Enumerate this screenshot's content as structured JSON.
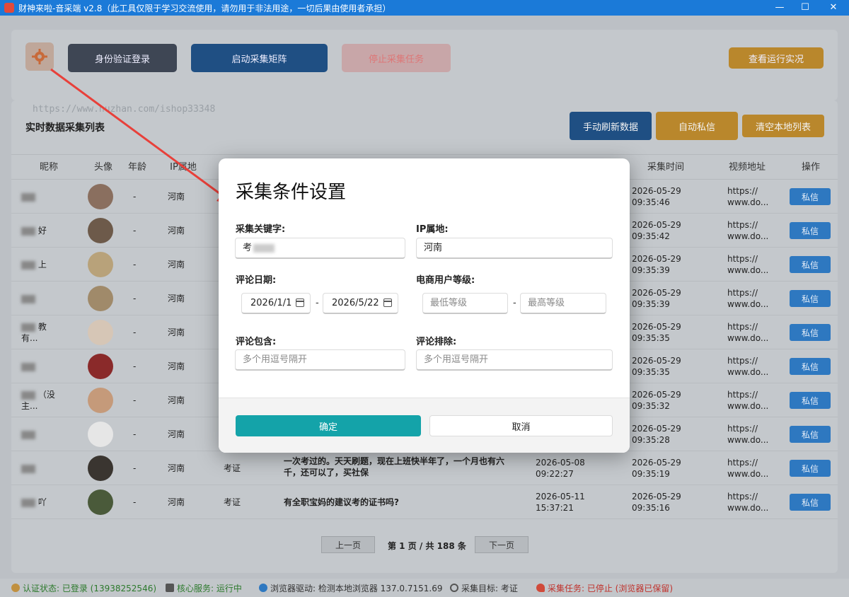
{
  "window": {
    "title": "财神来啦-音采端 v2.8（此工具仅限于学习交流使用，请勿用于非法用途，一切后果由使用者承担）"
  },
  "toolbar": {
    "login": "身份验证登录",
    "start": "启动采集矩阵",
    "stop": "停止采集任务",
    "view": "查看运行实况"
  },
  "list": {
    "watermark": "https://www.huzhan.com/ishop33348",
    "title": "实时数据采集列表",
    "refresh": "手动刷新数据",
    "auto_dm": "自动私信",
    "clear": "清空本地列表",
    "headers": [
      "昵称",
      "头像",
      "年龄",
      "IP属地",
      "采集时间",
      "视频地址",
      "操作"
    ],
    "rows": [
      {
        "nick": "    ",
        "age": "-",
        "ip": "河南",
        "kw": "",
        "comment": "",
        "ctime1": "",
        "ctime2": "",
        "time1": "2026-05-29",
        "time2": "09:35:46",
        "url1": "https://",
        "url2": "www.do...",
        "action": "私信"
      },
      {
        "nick": "    好",
        "age": "-",
        "ip": "河南",
        "kw": "",
        "comment": "",
        "ctime1": "",
        "ctime2": "",
        "time1": "2026-05-29",
        "time2": "09:35:42",
        "url1": "https://",
        "url2": "www.do...",
        "action": "私信"
      },
      {
        "nick": "    上",
        "age": "-",
        "ip": "河南",
        "kw": "",
        "comment": "",
        "ctime1": "",
        "ctime2": "",
        "time1": "2026-05-29",
        "time2": "09:35:39",
        "url1": "https://",
        "url2": "www.do...",
        "action": "私信"
      },
      {
        "nick": "    ",
        "age": "-",
        "ip": "河南",
        "kw": "",
        "comment": "",
        "ctime1": "",
        "ctime2": "",
        "time1": "2026-05-29",
        "time2": "09:35:39",
        "url1": "https://",
        "url2": "www.do...",
        "action": "私信"
      },
      {
        "nick": "  教",
        "nick2": "  有...",
        "age": "-",
        "ip": "河南",
        "kw": "",
        "comment": "",
        "ctime1": "",
        "ctime2": "",
        "time1": "2026-05-29",
        "time2": "09:35:35",
        "url1": "https://",
        "url2": "www.do...",
        "action": "私信"
      },
      {
        "nick": "    ",
        "age": "-",
        "ip": "河南",
        "kw": "",
        "comment": "",
        "ctime1": "",
        "ctime2": "",
        "time1": "2026-05-29",
        "time2": "09:35:35",
        "url1": "https://",
        "url2": "www.do...",
        "action": "私信"
      },
      {
        "nick": "  （没",
        "nick2": "  主...",
        "age": "-",
        "ip": "河南",
        "kw": "",
        "comment": "",
        "ctime1": "",
        "ctime2": "",
        "time1": "2026-05-29",
        "time2": "09:35:32",
        "url1": "https://",
        "url2": "www.do...",
        "action": "私信"
      },
      {
        "nick": "    ",
        "age": "-",
        "ip": "河南",
        "kw": "",
        "comment": "",
        "ctime1": "",
        "ctime2": "",
        "time1": "2026-05-29",
        "time2": "09:35:28",
        "url1": "https://",
        "url2": "www.do...",
        "action": "私信"
      },
      {
        "nick": "    ",
        "age": "-",
        "ip": "河南",
        "kw": "考证",
        "comment": "一次考过的。天天刷题，现在上班快半年了，一个月也有六千，还可以了，买社保",
        "ctime1": "2026-05-08",
        "ctime2": "09:22:27",
        "time1": "2026-05-29",
        "time2": "09:35:19",
        "url1": "https://",
        "url2": "www.do...",
        "action": "私信"
      },
      {
        "nick": "  吖",
        "age": "-",
        "ip": "河南",
        "kw": "考证",
        "comment": "有全职宝妈的建议考的证书吗?",
        "ctime1": "2026-05-11",
        "ctime2": "15:37:21",
        "time1": "2026-05-29",
        "time2": "09:35:16",
        "url1": "https://",
        "url2": "www.do...",
        "action": "私信"
      }
    ],
    "pager": {
      "prev": "上一页",
      "info": "第 1 页 / 共 188 条",
      "next": "下一页"
    }
  },
  "status": {
    "auth": "认证状态: 已登录 (13938252546)",
    "core": "核心服务: 运行中",
    "browser": "浏览器驱动: 检测本地浏览器 137.0.7151.69",
    "target": "采集目标: 考证",
    "task": "采集任务: 已停止 (浏览器已保留)"
  },
  "dialog": {
    "title": "采集条件设置",
    "keyword_label": "采集关键字:",
    "keyword_value": "考",
    "ip_label": "IP属地:",
    "ip_value": "河南",
    "date_label": "评论日期:",
    "date_from": "2026/1/1",
    "date_to": "2026/5/22",
    "level_label": "电商用户等级:",
    "level_min_placeholder": "最低等级",
    "level_max_placeholder": "最高等级",
    "include_label": "评论包含:",
    "include_placeholder": "多个用逗号隔开",
    "exclude_label": "评论排除:",
    "exclude_placeholder": "多个用逗号隔开",
    "ok": "确定",
    "cancel": "取消"
  },
  "colors": {
    "titlebar": "#1b7ad8",
    "ok_button": "#14a3a9",
    "arrow": "#e8403a",
    "status_auth": "#2d7a2d",
    "status_task": "#c0312b"
  }
}
